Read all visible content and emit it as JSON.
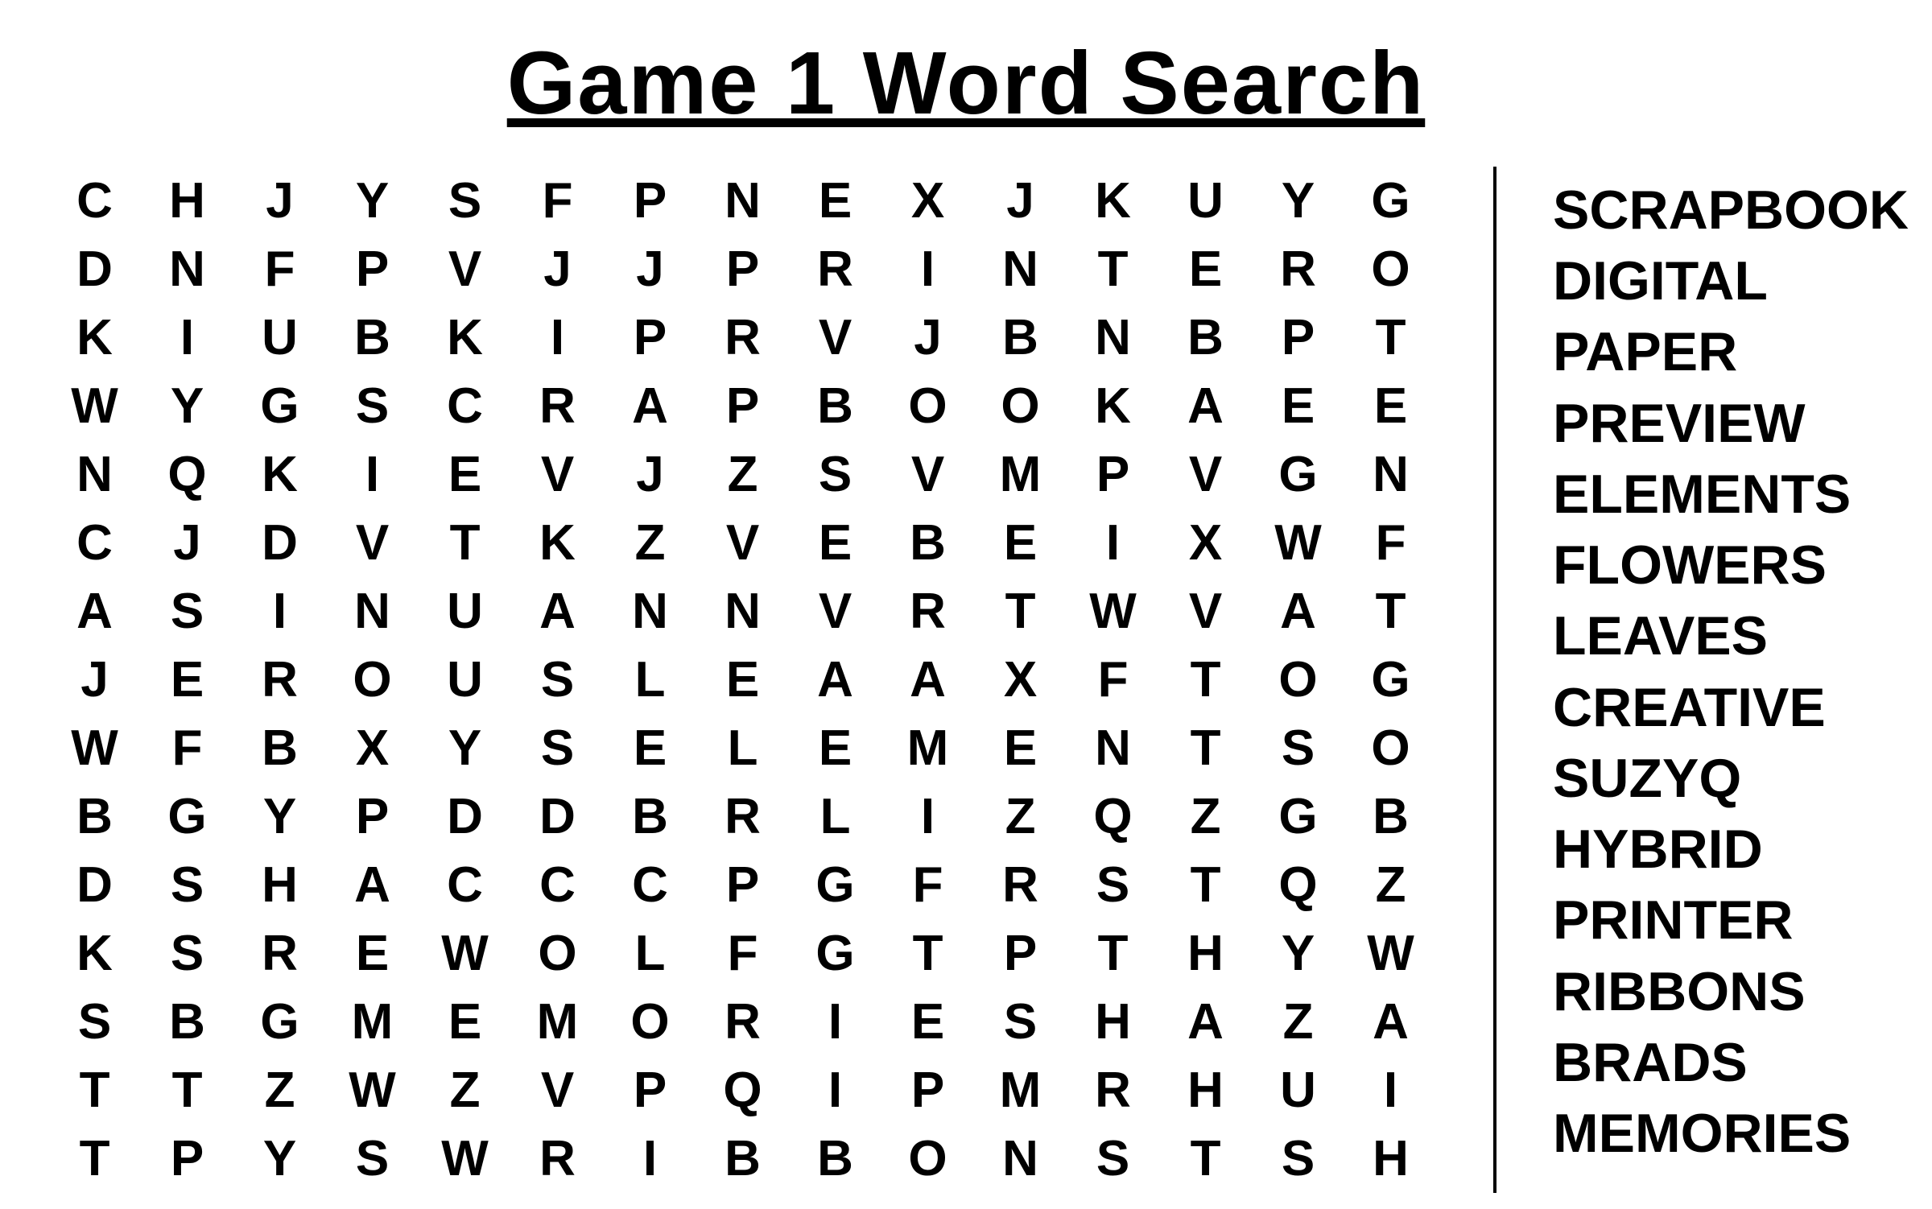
{
  "title": "Game 1 Word Search",
  "grid": [
    [
      "C",
      "H",
      "J",
      "Y",
      "S",
      "F",
      "P",
      "N",
      "E",
      "X",
      "J",
      "K",
      "U",
      "Y",
      "G"
    ],
    [
      "D",
      "N",
      "F",
      "P",
      "V",
      "J",
      "J",
      "P",
      "R",
      "I",
      "N",
      "T",
      "E",
      "R",
      "O"
    ],
    [
      "K",
      "I",
      "U",
      "B",
      "K",
      "I",
      "P",
      "R",
      "V",
      "J",
      "B",
      "N",
      "B",
      "P",
      "T"
    ],
    [
      "W",
      "Y",
      "G",
      "S",
      "C",
      "R",
      "A",
      "P",
      "B",
      "O",
      "O",
      "K",
      "A",
      "E",
      "E"
    ],
    [
      "N",
      "Q",
      "K",
      "I",
      "E",
      "V",
      "J",
      "Z",
      "S",
      "V",
      "M",
      "P",
      "V",
      "G",
      "N"
    ],
    [
      "C",
      "J",
      "D",
      "V",
      "T",
      "K",
      "Z",
      "V",
      "E",
      "B",
      "E",
      "I",
      "X",
      "W",
      "F"
    ],
    [
      "A",
      "S",
      "I",
      "N",
      "U",
      "A",
      "N",
      "N",
      "V",
      "R",
      "T",
      "W",
      "V",
      "A",
      "T"
    ],
    [
      "J",
      "E",
      "R",
      "O",
      "U",
      "S",
      "L",
      "E",
      "A",
      "A",
      "X",
      "F",
      "T",
      "O",
      "G"
    ],
    [
      "W",
      "F",
      "B",
      "X",
      "Y",
      "S",
      "E",
      "L",
      "E",
      "M",
      "E",
      "N",
      "T",
      "S",
      "O"
    ],
    [
      "B",
      "G",
      "Y",
      "P",
      "D",
      "D",
      "B",
      "R",
      "L",
      "I",
      "Z",
      "Q",
      "Z",
      "G",
      "B"
    ],
    [
      "D",
      "S",
      "H",
      "A",
      "C",
      "C",
      "C",
      "P",
      "G",
      "F",
      "R",
      "S",
      "T",
      "Q",
      "Z"
    ],
    [
      "K",
      "S",
      "R",
      "E",
      "W",
      "O",
      "L",
      "F",
      "G",
      "T",
      "P",
      "T",
      "H",
      "Y",
      "W"
    ],
    [
      "S",
      "B",
      "G",
      "M",
      "E",
      "M",
      "O",
      "R",
      "I",
      "E",
      "S",
      "H",
      "A",
      "Z",
      "A"
    ],
    [
      "T",
      "T",
      "Z",
      "W",
      "Z",
      "V",
      "P",
      "Q",
      "I",
      "P",
      "M",
      "R",
      "H",
      "U",
      "I"
    ],
    [
      "T",
      "P",
      "Y",
      "S",
      "W",
      "R",
      "I",
      "B",
      "B",
      "O",
      "N",
      "S",
      "T",
      "S",
      "H"
    ]
  ],
  "words": [
    "SCRAPBOOK",
    "DIGITAL",
    "PAPER",
    "PREVIEW",
    "ELEMENTS",
    "FLOWERS",
    "LEAVES",
    "CREATIVE",
    "SUZYQ",
    "HYBRID",
    "PRINTER",
    "RIBBONS",
    "BRADS",
    "MEMORIES"
  ]
}
